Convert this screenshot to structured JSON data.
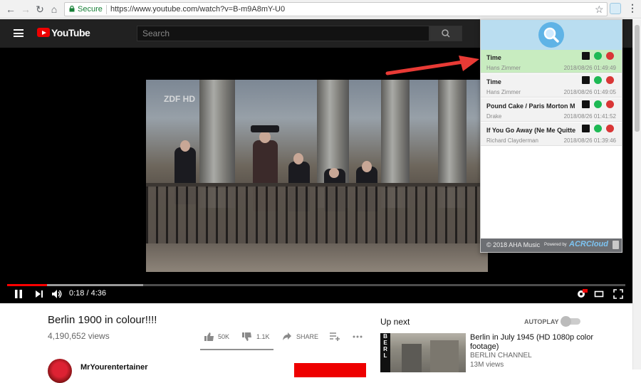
{
  "browser": {
    "secure_label": "Secure",
    "url": "https://www.youtube.com/watch?v=B-m9A8mY-U0"
  },
  "youtube": {
    "brand": "YouTube",
    "search_placeholder": "Search"
  },
  "player": {
    "watermark": "ZDF HD",
    "time": "0:18 / 4:36",
    "progress_fraction": 0.065
  },
  "video": {
    "title": "Berlin 1900 in colour!!!!",
    "views": "4,190,652 views",
    "likes": "50K",
    "dislikes": "1.1K",
    "share_label": "SHARE",
    "channel": "MrYourentertainer"
  },
  "sidebar": {
    "up_next": "Up next",
    "autoplay": "AUTOPLAY",
    "thumb_letters": [
      "B",
      "E",
      "R",
      "L"
    ],
    "recommended": {
      "title": "Berlin in July 1945 (HD 1080p color footage)",
      "channel": "BERLIN CHANNEL",
      "views": "13M views"
    }
  },
  "popup": {
    "history": [
      {
        "title": "Time",
        "artist": "Hans Zimmer",
        "date": "2018/08/26 01:49:49",
        "active": true
      },
      {
        "title": "Time",
        "artist": "Hans Zimmer",
        "date": "2018/08/26 01:49:05",
        "active": false
      },
      {
        "title": "Pound Cake / Paris Morton M",
        "artist": "Drake",
        "date": "2018/08/26 01:41:52",
        "active": false
      },
      {
        "title": "If You Go Away (Ne Me Quitte",
        "artist": "Richard Clayderman",
        "date": "2018/08/26 01:39:46",
        "active": false
      }
    ],
    "copyright": "© 2018 AHA Music",
    "powered_by": "Powered by",
    "provider": "ACRCloud"
  },
  "colors": {
    "youtube_red": "#ff0000",
    "active_row": "#c8ecc0",
    "popup_header": "#b9ddf0",
    "annotation_arrow": "#e83a35"
  }
}
